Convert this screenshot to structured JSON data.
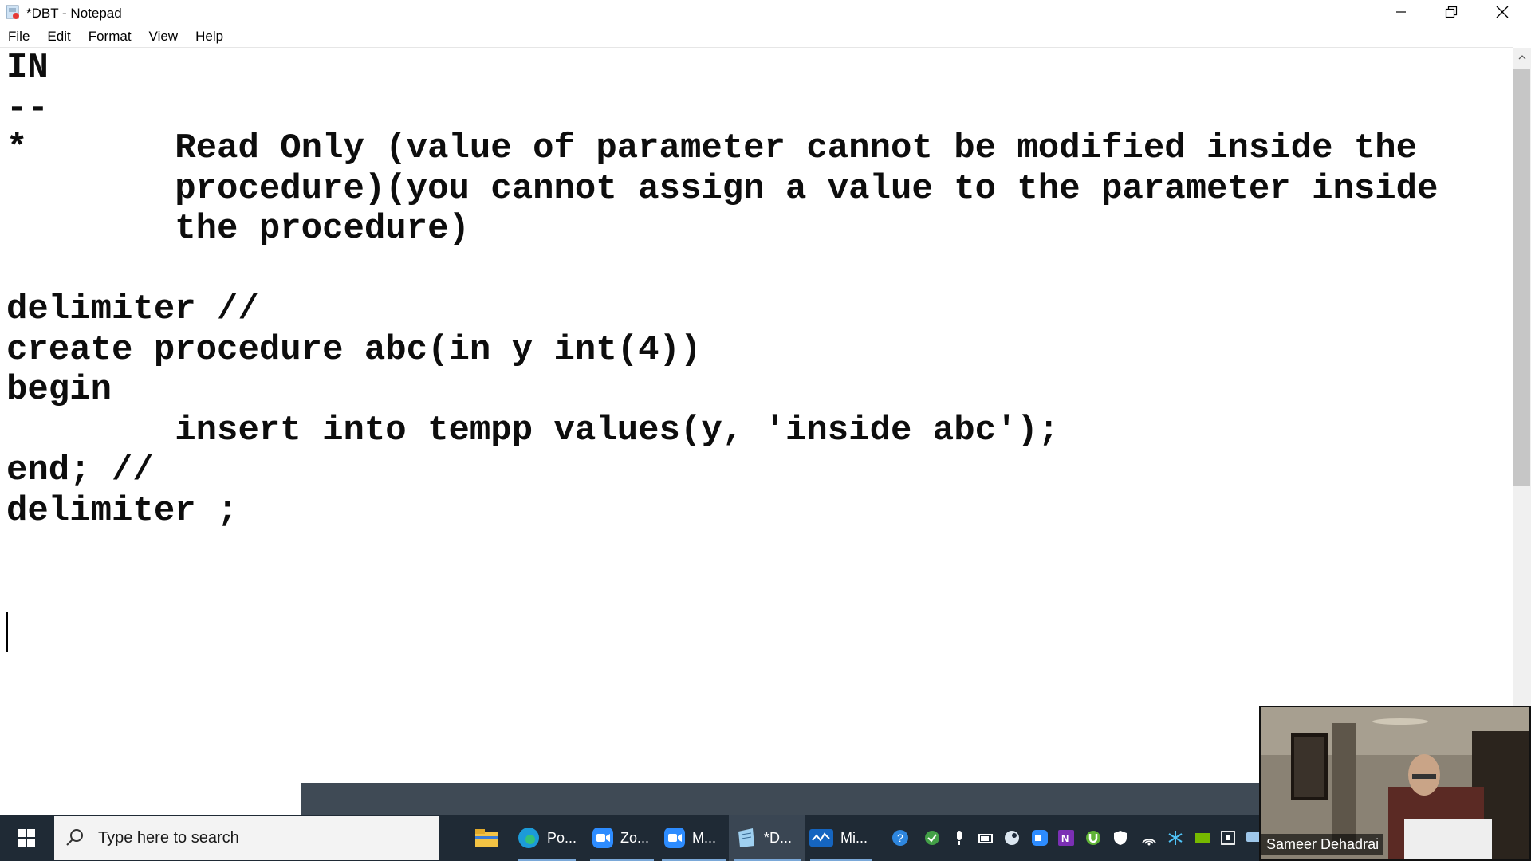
{
  "window": {
    "title": "*DBT - Notepad",
    "controls": {
      "minimize": "minimize",
      "restore": "restore",
      "close": "close"
    }
  },
  "menu": [
    "File",
    "Edit",
    "Format",
    "View",
    "Help"
  ],
  "editor": {
    "lines": [
      "IN",
      "--",
      "*       Read Only (value of parameter cannot be modified inside the",
      "        procedure)(you cannot assign a value to the parameter inside",
      "        the procedure)",
      "",
      "delimiter //",
      "create procedure abc(in y int(4))",
      "begin",
      "        insert into tempp values(y, 'inside abc');",
      "end; //",
      "delimiter ;"
    ]
  },
  "taskbar": {
    "search_placeholder": "Type here to search",
    "apps": [
      {
        "icon": "file-explorer-icon",
        "label": ""
      },
      {
        "icon": "edge-icon",
        "label": "Po..."
      },
      {
        "icon": "zoom-icon",
        "label": "Zo..."
      },
      {
        "icon": "zoom-meeting-icon",
        "label": "M..."
      },
      {
        "icon": "notepad-icon",
        "label": "*D..."
      },
      {
        "icon": "whiteboard-icon",
        "label": "Mi..."
      }
    ]
  },
  "webcam": {
    "participant_name": "Sameer Dehadrai"
  },
  "colors": {
    "taskbar": "#1f2a35",
    "strip": "#3f4a55",
    "scroll_thumb": "#c6c6c6"
  }
}
